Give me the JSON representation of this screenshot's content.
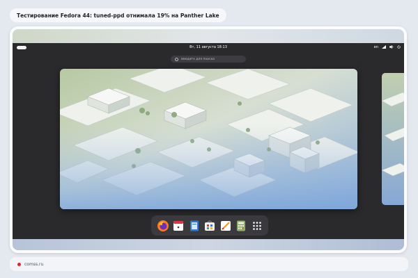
{
  "article": {
    "headline": "Тестирование Fedora 44: tuned-ppd отнимала 19% на Panther Lake"
  },
  "gnome": {
    "topbar": {
      "clock": "Вт, 11 августа 18:13",
      "tray": [
        "en",
        "network-icon",
        "volume-icon",
        "power-icon"
      ],
      "tray_label": "en"
    },
    "search": {
      "placeholder": "Введите для поиска"
    },
    "dock": {
      "apps": [
        "firefox",
        "calendar",
        "text-editor",
        "software",
        "drawing",
        "calculator",
        "app-grid"
      ]
    }
  },
  "footer": {
    "site": "comss.ru"
  },
  "colors": {
    "accent_red": "#e0242f",
    "shell_dark": "#2a2a2d",
    "dock": "#3a3a3e"
  }
}
